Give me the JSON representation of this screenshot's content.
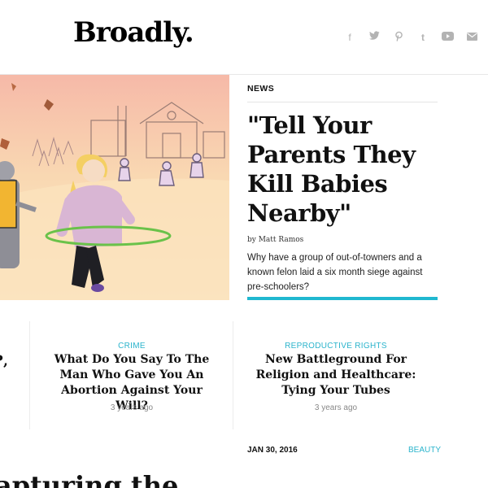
{
  "header": {
    "logo": "Broadly.",
    "social_icons": [
      "facebook-icon",
      "twitter-icon",
      "pinterest-icon",
      "tumblr-icon",
      "youtube-icon",
      "mail-icon"
    ]
  },
  "hero": {
    "category": "NEWS",
    "headline": "\"Tell Your Parents They Kill Babies Nearby\"",
    "byline": "by Matt Ramos",
    "summary": "Why have a group of out-of-towners and a known felon laid a six month siege against pre-schoolers?",
    "accent_color": "#20b8d0"
  },
  "cards": [
    {
      "category": "CRIME",
      "title": "What Do You Say To The Man Who Gave You An Abortion Against Your Will?",
      "time": "3 years ago"
    },
    {
      "category": "REPRODUCTIVE RIGHTS",
      "title": "New Battleground For Religion and Healthcare: Tying Your Tubes",
      "time": "3 years ago"
    }
  ],
  "partial_card": {
    "text": "?,\n,"
  },
  "bottom": {
    "date": "JAN 30, 2016",
    "category": "BEAUTY",
    "headline": "apturing the"
  }
}
